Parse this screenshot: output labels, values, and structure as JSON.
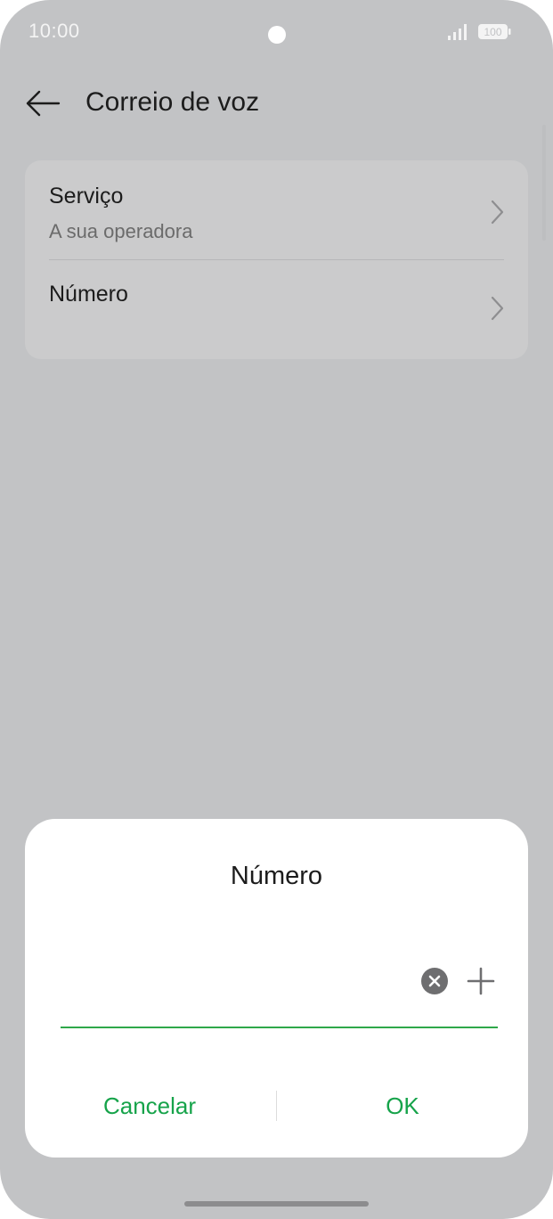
{
  "status_bar": {
    "time": "10:00",
    "battery_level": "100"
  },
  "header": {
    "title": "Correio de voz"
  },
  "settings": {
    "items": [
      {
        "title": "Serviço",
        "subtitle": "A sua operadora"
      },
      {
        "title": "Número"
      }
    ]
  },
  "dialog": {
    "title": "Número",
    "input_value": "",
    "cancel_label": "Cancelar",
    "ok_label": "OK"
  },
  "colors": {
    "accent": "#16a34a",
    "scrim_background": "#c2c3c5",
    "card_background": "#cbcbcc"
  },
  "icons": {
    "back": "arrow-left-icon",
    "chevron": "chevron-right-icon",
    "clear": "clear-icon",
    "add": "plus-icon",
    "signal": "signal-icon",
    "battery": "battery-icon"
  }
}
